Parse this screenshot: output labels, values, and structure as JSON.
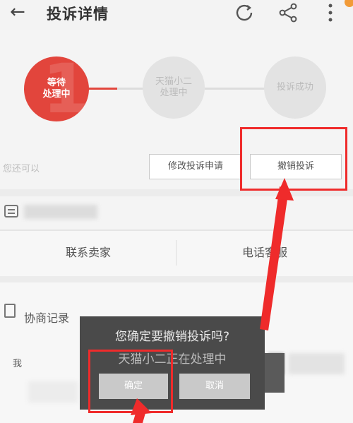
{
  "header": {
    "back_icon": "back-arrow-icon",
    "title": "投诉详情",
    "refresh_icon": "refresh-icon",
    "share_icon": "share-icon",
    "more_icon": "more-vertical-icon"
  },
  "progress": {
    "steps": [
      {
        "label": "等待\n处理中",
        "state": "active"
      },
      {
        "label": "天猫小二\n处理中",
        "state": "pending"
      },
      {
        "label": "投诉成功",
        "state": "pending"
      }
    ],
    "active_color": "#e2453c",
    "watermark_digit": "1"
  },
  "actions": {
    "label": "您还可以",
    "modify": "修改投诉申请",
    "revoke": "撤销投诉"
  },
  "contact": {
    "seller": "联系卖家",
    "phone": "电话客服"
  },
  "records": {
    "label": "协商记录",
    "me": "我"
  },
  "dialog": {
    "question": "您确定要撤销投诉吗?",
    "sub": "天猫小二正在处理中",
    "confirm": "确定",
    "cancel": "取消"
  },
  "annotation_color": "#ef2b2b"
}
